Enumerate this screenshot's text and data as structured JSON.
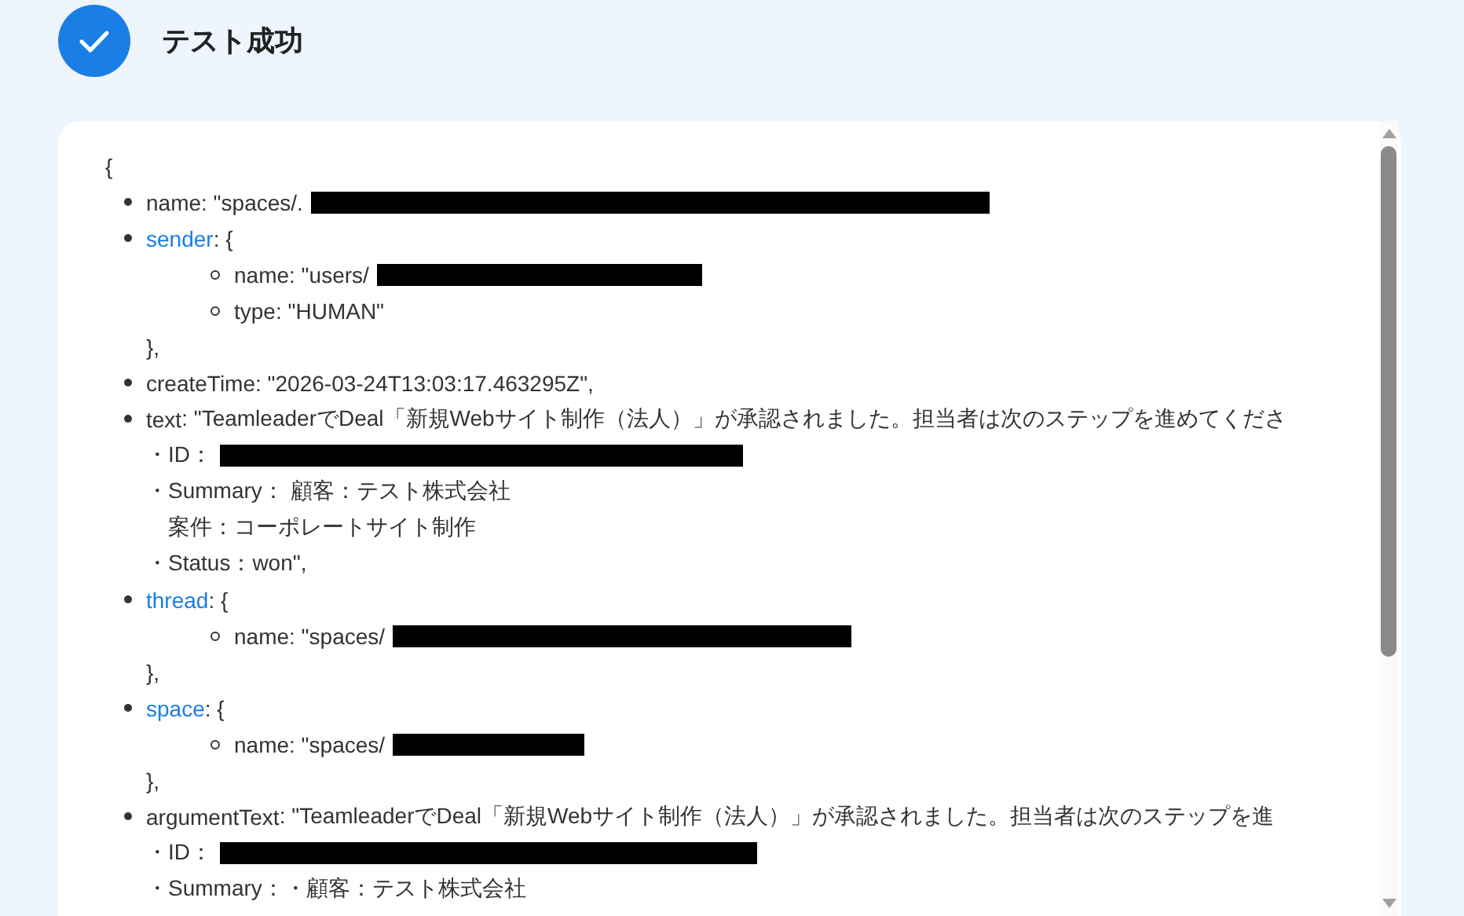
{
  "header": {
    "title": "テスト成功"
  },
  "json_view": {
    "open_brace": "{",
    "fields": [
      {
        "kind": "value",
        "key": "name",
        "value": ": \"spaces/.",
        "redacted": true
      },
      {
        "kind": "object",
        "key": "sender",
        "value": ": {",
        "close": "},",
        "children": [
          {
            "key": "name",
            "value": ": \"users/",
            "redacted": true
          },
          {
            "key": "type",
            "value": ": \"HUMAN\""
          }
        ]
      },
      {
        "kind": "value",
        "key": "createTime",
        "value": ": \"2026-03-24T13:03:17.463295Z\","
      },
      {
        "kind": "value",
        "key": "text",
        "value": ": \"TeamleaderでDeal「新規Webサイト制作（法人）」が承認されました。担当者は次のステップを進めてくださ",
        "lines": [
          {
            "text": "・ID：",
            "redacted": true
          },
          {
            "text": "・Summary： 顧客：テスト株式会社"
          },
          {
            "text": "　案件：コーポレートサイト制作"
          },
          {
            "text": "・Status：won\","
          }
        ]
      },
      {
        "kind": "object",
        "key": "thread",
        "value": ": {",
        "close": "},",
        "children": [
          {
            "key": "name",
            "value": ": \"spaces/",
            "redacted": true
          }
        ]
      },
      {
        "kind": "object",
        "key": "space",
        "value": ": {",
        "close": "},",
        "children": [
          {
            "key": "name",
            "value": ": \"spaces/",
            "redacted": true
          }
        ]
      },
      {
        "kind": "value",
        "key": "argumentText",
        "value": ": \"TeamleaderでDeal「新規Webサイト制作（法人）」が承認されました。担当者は次のステップを進",
        "lines": [
          {
            "text": "・ID：",
            "redacted": true
          },
          {
            "text": "・Summary：・顧客：テスト株式会社"
          }
        ]
      }
    ]
  }
}
